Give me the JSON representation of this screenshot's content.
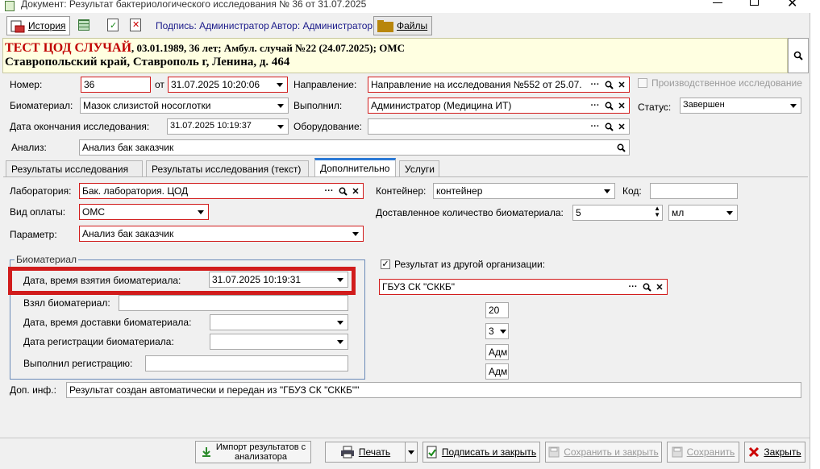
{
  "window": {
    "title": "Документ: Результат бактериологического исследования №  36 от 31.07.2025"
  },
  "toolbar": {
    "history": "История",
    "signature": "Подпись: Администратор",
    "author": "Автор: Администратор",
    "files": "Файлы"
  },
  "patient": {
    "name": "ТЕСТ ЦОД СЛУЧАЙ",
    "details": ", 03.01.1989, 36 лет; Амбул. случай №22 (24.07.2025); ОМС",
    "address": "Ставропольский край, Ставрополь г, Ленина, д. 464"
  },
  "form": {
    "number_label": "Номер:",
    "number_value": "36",
    "from_label": "от",
    "from_value": "31.07.2025 10:20:06",
    "direction_label": "Направление:",
    "direction_value": "Направление на исследования №552 от 25.07.",
    "production_label": "Производственное исследование",
    "biomaterial_label": "Биоматериал:",
    "biomaterial_value": "Мазок слизистой носоглотки",
    "performed_label": "Выполнил:",
    "performed_value": "Администратор (Медицина ИТ)",
    "status_label": "Статус:",
    "status_value": "Завершен",
    "end_date_label": "Дата окончания исследования:",
    "end_date_value": "31.07.2025 10:19:37",
    "equipment_label": "Оборудование:",
    "equipment_value": "",
    "analysis_label": "Анализ:",
    "analysis_value": "Анализ бак заказчик"
  },
  "tabs": [
    {
      "label": "Результаты исследования"
    },
    {
      "label": "Результаты исследования (текст)"
    },
    {
      "label": "Дополнительно"
    },
    {
      "label": "Услуги"
    }
  ],
  "extra": {
    "lab_label": "Лаборатория:",
    "lab_value": "Бак. лаборатория. ЦОД",
    "container_label": "Контейнер:",
    "container_value": "контейнер",
    "code_label": "Код:",
    "code_value": "",
    "payment_label": "Вид оплаты:",
    "payment_value": "ОМС",
    "quantity_label": "Доставленное количество биоматериала:",
    "quantity_value": "5",
    "unit_value": "мл",
    "param_label": "Параметр:",
    "param_value": "Анализ бак заказчик",
    "group_title": "Биоматериал",
    "taken_dt_label": "Дата, время взятия биоматериала:",
    "taken_dt_value": "31.07.2025 10:19:31",
    "taken_by_label": "Взял биоматериал:",
    "taken_by_value": "",
    "delivery_label": "Дата, время доставки биоматериала:",
    "delivery_value": "",
    "reg_date_label": "Дата регистрации биоматериала:",
    "reg_date_value": "",
    "reg_by_label": "Выполнил регистрацию:",
    "reg_by_value": "",
    "other_org_label": "Результат из другой организации:",
    "org_value": "ГБУЗ СК \"СККБ\"",
    "small1": "20",
    "small2": "3",
    "small3": "Адм",
    "small4": "Адм",
    "info_label": "Доп. инф.:",
    "info_value": "Результат создан автоматически и передан из \"ГБУЗ СК \"СККБ\"\""
  },
  "footer": {
    "import_line1": "Импорт результатов с",
    "import_line2": "анализатора",
    "print": "Печать",
    "sign_close": "Подписать и закрыть",
    "save_close": "Сохранить и закрыть",
    "save": "Сохранить",
    "close": "Закрыть"
  },
  "colors": {
    "required_border": "#d11c1c",
    "highlight_box": "#d11c1c",
    "patient_bg": "#ffffe1",
    "tab_accent": "#2b79d6"
  }
}
